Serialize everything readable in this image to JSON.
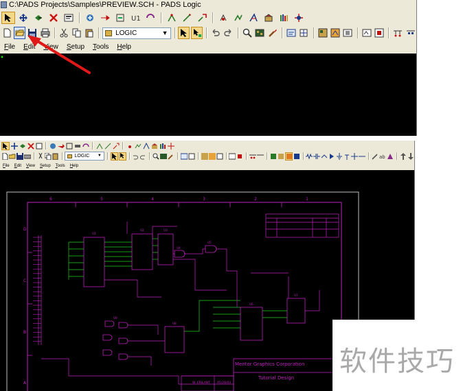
{
  "top_window": {
    "title": "C:\\PADS Projects\\Samples\\PREVIEW.SCH - PADS Logic",
    "layer_combo": "LOGIC",
    "menu": [
      "File",
      "Edit",
      "View",
      "Setup",
      "Tools",
      "Help"
    ]
  },
  "bottom_window": {
    "layer_combo": "LOGIC",
    "menu": [
      "File",
      "Edit",
      "View",
      "Setup",
      "Tools",
      "Help"
    ],
    "grid_columns": [
      "6",
      "5",
      "4",
      "3",
      "2",
      "1"
    ],
    "grid_rows": [
      "D",
      "C",
      "B",
      "A"
    ],
    "title_block": {
      "company": "Mentor Graphics Corporation",
      "drawing_title": "Tutorial Design",
      "drawn_by": "W. ERILANT",
      "date": "05/28/03"
    },
    "component_labels": [
      "U1",
      "U2",
      "U3",
      "U4",
      "U5",
      "U6",
      "U7",
      "U8",
      "U9"
    ]
  },
  "watermark": "软件技巧",
  "colors": {
    "canvas": "#000000",
    "schematic": "#c020c0",
    "wires": "#20d020",
    "chrome": "#ece9d8",
    "arrow": "#e01818"
  }
}
